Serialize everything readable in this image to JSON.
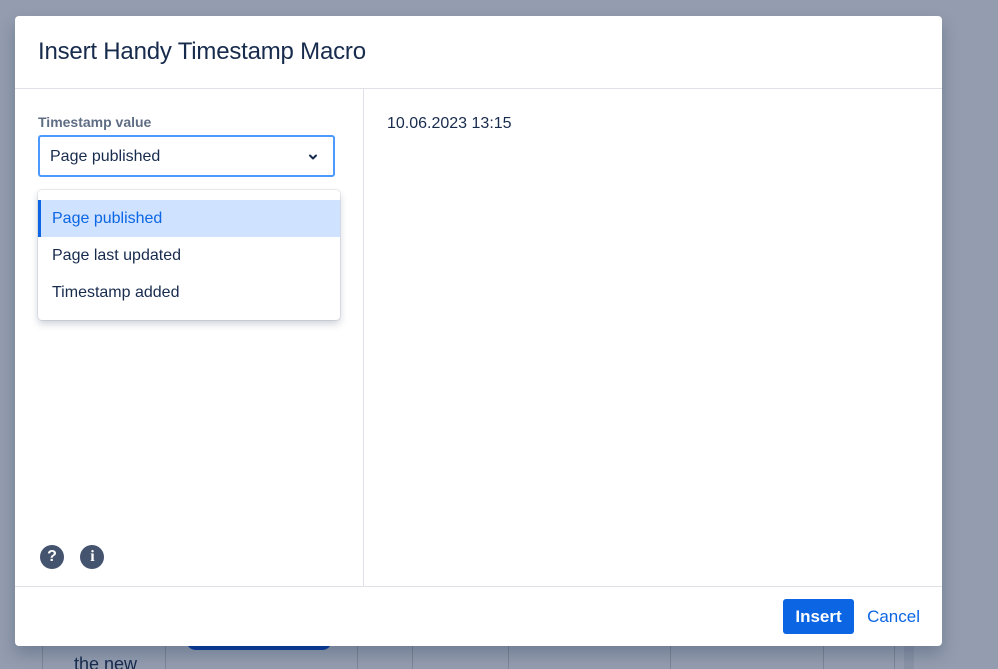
{
  "background": {
    "page_title": "",
    "table_text": "the new"
  },
  "dialog": {
    "title": "Insert Handy Timestamp Macro",
    "field_label": "Timestamp value",
    "select": {
      "value": "Page published",
      "options": [
        "Page published",
        "Page last updated",
        "Timestamp added"
      ],
      "selected_index": 0
    },
    "preview_value": "10.06.2023 13:15",
    "icons": [
      "help-icon",
      "info-icon"
    ],
    "buttons": {
      "insert": "Insert",
      "cancel": "Cancel"
    }
  },
  "colors": {
    "primary": "#0c66e4",
    "focus_border": "#4c9aff",
    "selected_option_bg": "#cfe2ff",
    "overlay": "#949daf"
  }
}
